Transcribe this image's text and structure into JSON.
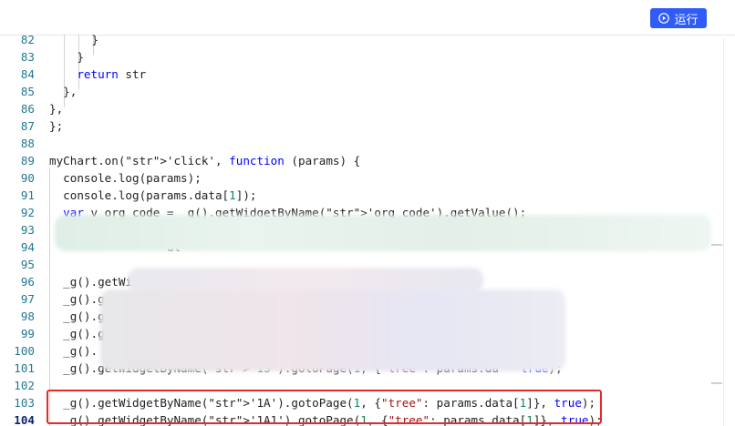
{
  "toolbar": {
    "run_label": "运行",
    "run_icon": "play-circle-icon",
    "accent_color": "#2f5cf6"
  },
  "editor": {
    "lines": [
      {
        "n": "82",
        "text": "    }"
      },
      {
        "n": "83",
        "text": "    }"
      },
      {
        "n": "84",
        "text": "    return str"
      },
      {
        "n": "85",
        "text": "  },"
      },
      {
        "n": "86",
        "text": "},"
      },
      {
        "n": "87",
        "text": "};"
      },
      {
        "n": "88",
        "text": ""
      },
      {
        "n": "89",
        "text": "myChart.on('click', function (params) {"
      },
      {
        "n": "90",
        "text": "  console.log(params);"
      },
      {
        "n": "91",
        "text": "  console.log(params.data[1]);"
      },
      {
        "n": "92",
        "text": "  var v_org_code = _g().getWidgetByName('org_code').getValue();"
      },
      {
        "n": "93",
        "text": "                         ot=90 木同"
      },
      {
        "n": "94",
        "text": "                 ul"
      },
      {
        "n": "95",
        "text": ""
      },
      {
        "n": "96",
        "text": "  _g().getWi"
      },
      {
        "n": "97",
        "text": "  _g().getW"
      },
      {
        "n": "98",
        "text": "  _g().getWidgetByName('10').g"
      },
      {
        "n": "99",
        "text": "  _g().g"
      },
      {
        "n": "100",
        "text": "  _g()."
      },
      {
        "n": "101",
        "text": "  _g().getWidgetByName('13').gotoPage(1, {\"tree\": params.da"
      },
      {
        "n": "102",
        "text": ""
      },
      {
        "n": "103",
        "text": "  _g().getWidgetByName('1A').gotoPage(1, {\"tree\": params.data[1]}, true);"
      },
      {
        "n": "104",
        "text": "  _g().getWidgetByName('1A1').gotoPage(1, {\"tree\": params.data[1]}, true);"
      }
    ],
    "line_101_tail": "  true);"
  },
  "annotation": {
    "highlight_color": "#e42a2a"
  }
}
